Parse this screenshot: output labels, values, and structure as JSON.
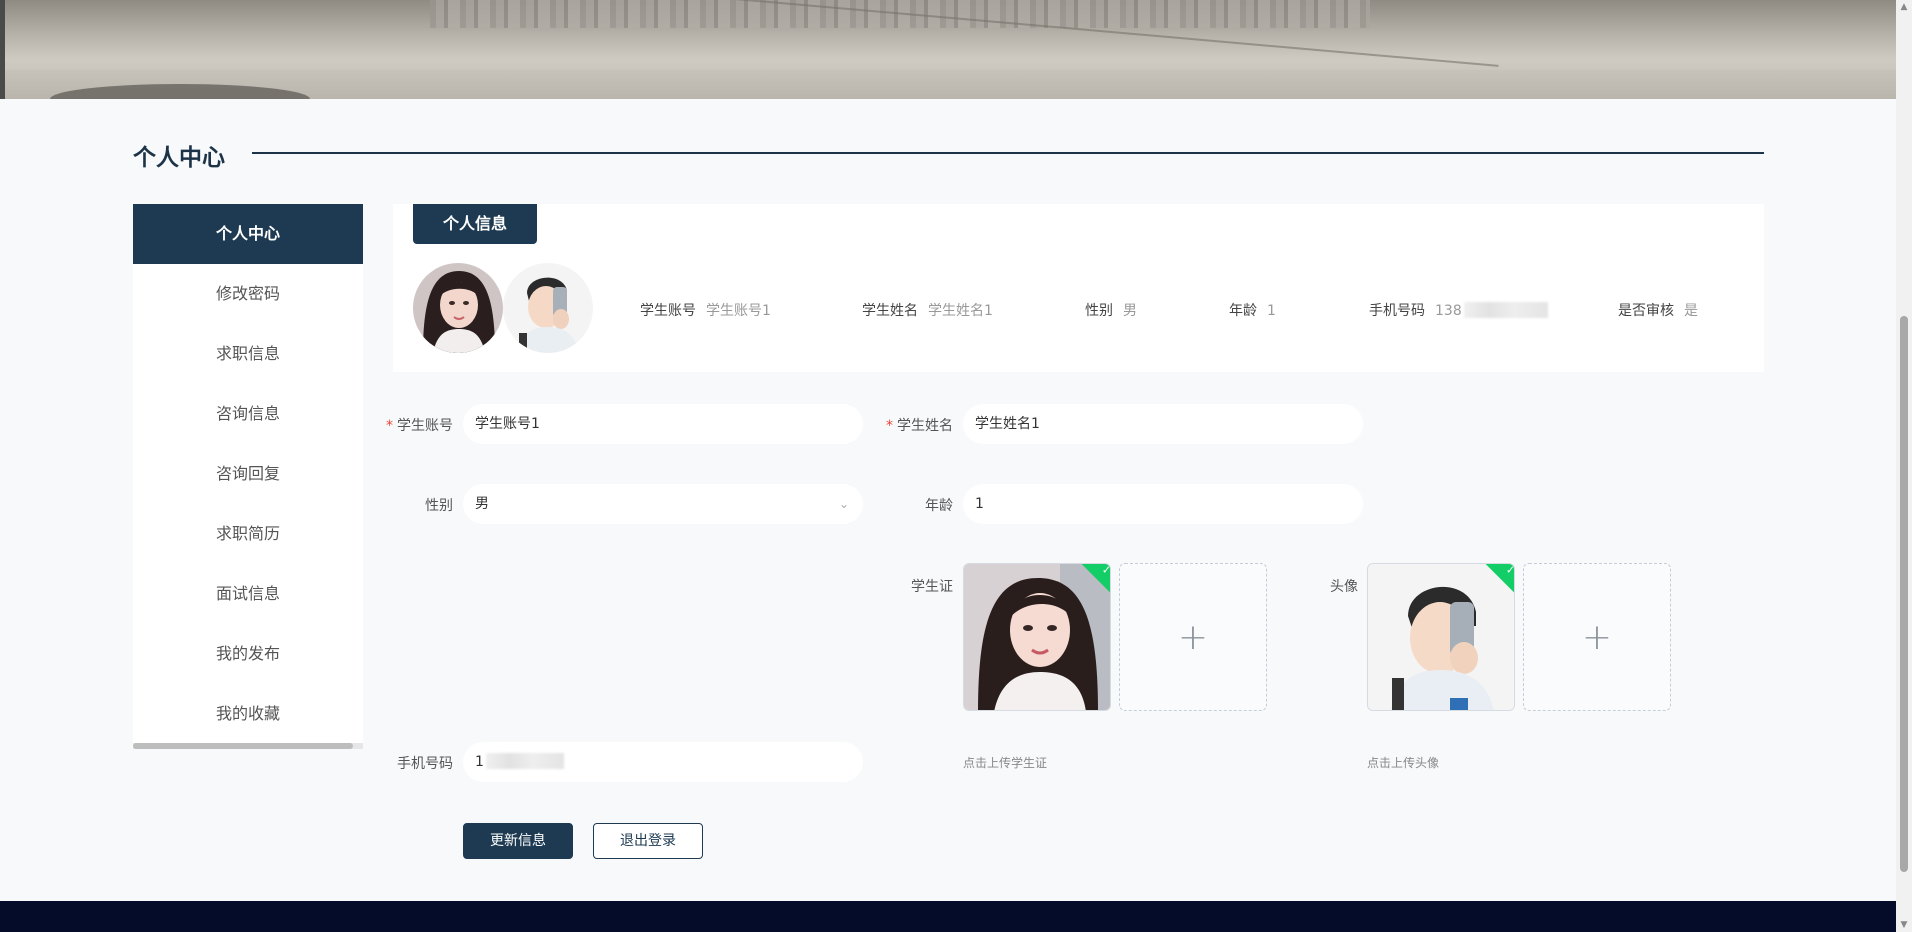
{
  "section_title": "个人中心",
  "sidebar": {
    "items": [
      {
        "label": "个人中心",
        "active": true
      },
      {
        "label": "修改密码"
      },
      {
        "label": "求职信息"
      },
      {
        "label": "咨询信息"
      },
      {
        "label": "咨询回复"
      },
      {
        "label": "求职简历"
      },
      {
        "label": "面试信息"
      },
      {
        "label": "我的发布"
      },
      {
        "label": "我的收藏"
      }
    ]
  },
  "info": {
    "tag": "个人信息",
    "account_key": "学生账号",
    "account_val": "学生账号1",
    "name_key": "学生姓名",
    "name_val": "学生姓名1",
    "gender_key": "性别",
    "gender_val": "男",
    "age_key": "年龄",
    "age_val": "1",
    "phone_key": "手机号码",
    "phone_val": "138",
    "audit_key": "是否审核",
    "audit_val": "是"
  },
  "form": {
    "account_label": "学生账号",
    "account_value": "学生账号1",
    "name_label": "学生姓名",
    "name_value": "学生姓名1",
    "gender_label": "性别",
    "gender_value": "男",
    "age_label": "年龄",
    "age_value": "1",
    "student_card_label": "学生证",
    "avatar_label": "头像",
    "phone_label": "手机号码",
    "phone_value": "1",
    "student_card_hint": "点击上传学生证",
    "avatar_hint": "点击上传头像",
    "upload_plus": "+",
    "check_mark": "✓"
  },
  "buttons": {
    "update": "更新信息",
    "logout": "退出登录"
  },
  "colors": {
    "primary": "#1d3a52",
    "required": "#e8463a",
    "success": "#13ce66",
    "footer": "#050c2a"
  }
}
